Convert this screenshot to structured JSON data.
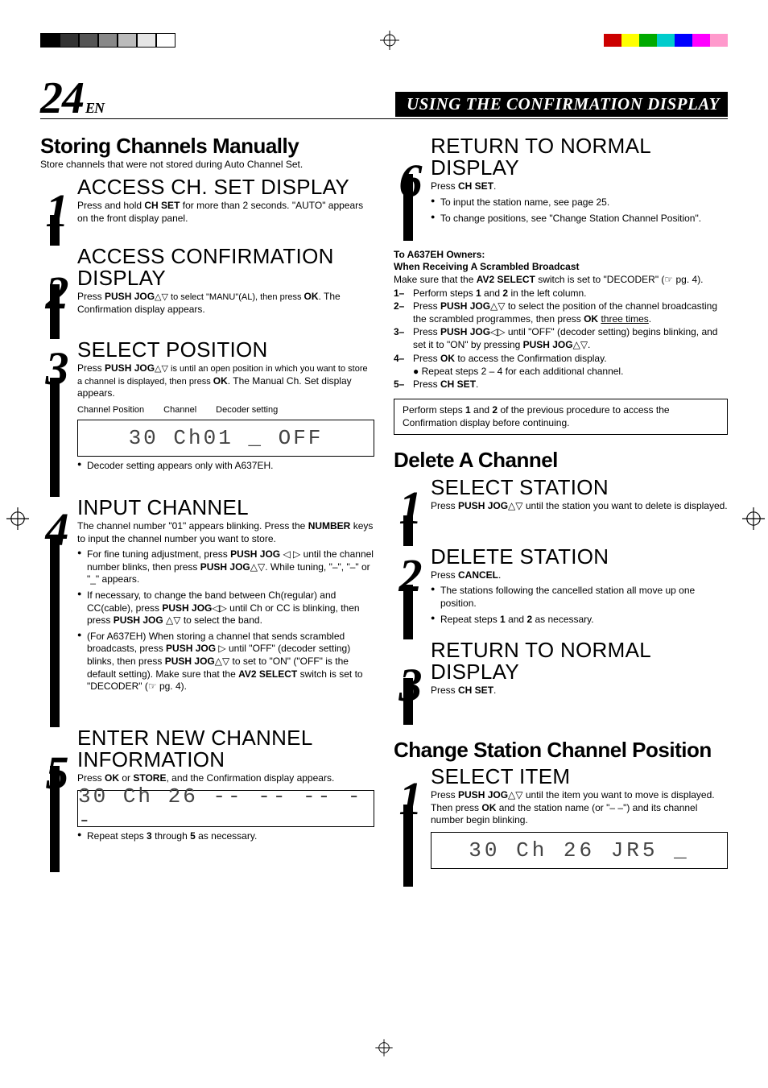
{
  "page_number": "24",
  "page_lang": "EN",
  "banner_title": "USING THE CONFIRMATION DISPLAY",
  "left": {
    "store_heading": "Storing Channels Manually",
    "store_intro": "Store channels that were not stored during Auto Channel Set.",
    "step1_title": "ACCESS CH. SET DISPLAY",
    "step1_body_a": "Press and hold ",
    "step1_body_b": "CH SET",
    "step1_body_c": " for more than 2 seconds. \"AUTO\" appears on the front display panel.",
    "step2_title": "ACCESS CONFIRMATION DISPLAY",
    "step2_body_a": "Press ",
    "step2_body_b": "PUSH JOG",
    "step2_body_c": "△▽ to select \"MANU\"(AL), then press ",
    "step2_body_d": "OK",
    "step2_body_e": ". The Confirmation display appears.",
    "step3_title": "SELECT POSITION",
    "step3_body_a": "Press ",
    "step3_body_b": "PUSH JOG",
    "step3_body_c": "△▽ is until an open position in which you want to store a channel is displayed, then press ",
    "step3_body_d": "OK",
    "step3_body_e": ". The Manual Ch. Set display appears.",
    "step3_label_a": "Channel Position",
    "step3_label_b": "Channel",
    "step3_label_c": "Decoder setting",
    "step3_display": "30 Ch01 _ OFF",
    "step3_note": "Decoder setting appears only with A637EH.",
    "step4_title": "INPUT CHANNEL",
    "step4_body_a": "The channel number \"01\" appears blinking. Press the ",
    "step4_body_b": "NUMBER",
    "step4_body_c": " keys to input the channel number you want to store.",
    "step4_bullet1_a": "For fine tuning adjustment, press ",
    "step4_bullet1_b": "PUSH JOG",
    "step4_bullet1_c": " ◁ ▷ until the channel number blinks, then press ",
    "step4_bullet1_d": "PUSH JOG",
    "step4_bullet1_e": "△▽. While tuning, \"–\", \"–\" or \"_\" appears.",
    "step4_bullet2_a": "If necessary, to change the band between Ch(regular) and CC(cable), press ",
    "step4_bullet2_b": "PUSH JOG",
    "step4_bullet2_c": "◁▷ until Ch or CC is blinking, then press ",
    "step4_bullet2_d": "PUSH JOG",
    "step4_bullet2_e": " △▽ to select the band.",
    "step4_bullet3_a": "(For A637EH) When storing a channel that sends scrambled broadcasts, press ",
    "step4_bullet3_b": "PUSH JOG",
    "step4_bullet3_c": " ▷ until \"OFF\" (decoder setting) blinks, then press ",
    "step4_bullet3_d": "PUSH JOG",
    "step4_bullet3_e": "△▽ to set to \"ON\" (\"OFF\" is the default setting). Make sure that the ",
    "step4_bullet3_f": "AV2 SELECT",
    "step4_bullet3_g": " switch is set to \"DECODER\" (☞ pg. 4).",
    "step5_title": "ENTER NEW CHANNEL INFORMATION",
    "step5_body_a": "Press ",
    "step5_body_b": "OK",
    "step5_body_c": " or ",
    "step5_body_d": "STORE",
    "step5_body_e": ", and the Confirmation display appears.",
    "step5_display": "30 Ch 26 -- -- -- --",
    "step5_repeat": "Repeat steps 3 through 5 as necessary.",
    "step5_repeat_b1": "3",
    "step5_repeat_b2": "5"
  },
  "right": {
    "step6_title": "RETURN TO NORMAL DISPLAY",
    "step6_body_a": "Press ",
    "step6_body_b": "CH SET",
    "step6_body_c": ".",
    "step6_bullet1": "To input the station name, see page 25.",
    "step6_bullet2": "To change positions, see \"Change Station Channel Position\".",
    "owners_head": "To A637EH Owners:",
    "owners_sub": "When Receiving A Scrambled Broadcast",
    "owners_intro_a": "Make sure that the ",
    "owners_intro_b": "AV2 SELECT",
    "owners_intro_c": " switch is set to \"DECODER\" (☞ pg. 4).",
    "o1_n": "1–",
    "o1_a": "Perform steps ",
    "o1_b": "1",
    "o1_c": " and ",
    "o1_d": "2",
    "o1_e": " in the left column.",
    "o2_n": "2–",
    "o2_a": "Press ",
    "o2_b": "PUSH JOG",
    "o2_c": "△▽ to select the position of the channel broadcasting the scrambled programmes, then press ",
    "o2_d": "OK",
    "o2_e": " three times",
    "o2_f": ".",
    "o3_n": "3–",
    "o3_a": "Press ",
    "o3_b": "PUSH JOG",
    "o3_c": "◁▷ until \"OFF\" (decoder setting) begins blinking, and set it to \"ON\" by pressing ",
    "o3_d": "PUSH JOG",
    "o3_e": "△▽.",
    "o4_n": "4–",
    "o4_a": "Press ",
    "o4_b": "OK",
    "o4_c": " to access the Confirmation display.",
    "o4_sub": "Repeat steps 2 – 4 for each additional channel.",
    "o5_n": "5–",
    "o5_a": "Press ",
    "o5_b": "CH SET",
    "o5_c": ".",
    "note_a": "Perform steps ",
    "note_b": "1",
    "note_c": " and ",
    "note_d": "2",
    "note_e": " of the previous procedure to access the Confirmation display before continuing.",
    "delete_heading": "Delete A Channel",
    "d1_title": "SELECT STATION",
    "d1_body_a": "Press ",
    "d1_body_b": "PUSH JOG",
    "d1_body_c": "△▽ until the station you want to delete is displayed.",
    "d2_title": "DELETE STATION",
    "d2_body_a": "Press ",
    "d2_body_b": "CANCEL",
    "d2_body_c": ".",
    "d2_bullet1": "The stations following the cancelled station all move up one position.",
    "d2_bullet2_a": "Repeat steps ",
    "d2_bullet2_b": "1",
    "d2_bullet2_c": " and ",
    "d2_bullet2_d": "2",
    "d2_bullet2_e": " as necessary.",
    "d3_title": "RETURN TO NORMAL DISPLAY",
    "d3_body_a": "Press ",
    "d3_body_b": "CH SET",
    "d3_body_c": ".",
    "change_heading": "Change Station Channel Position",
    "c1_title": "SELECT ITEM",
    "c1_body_a": "Press ",
    "c1_body_b": "PUSH JOG",
    "c1_body_c": "△▽ until the item you want to move is displayed. Then press ",
    "c1_body_d": "OK",
    "c1_body_e": " and the station name (or \"– –\") and its channel number begin blinking.",
    "c1_display": "30 Ch 26 JR5 _"
  }
}
